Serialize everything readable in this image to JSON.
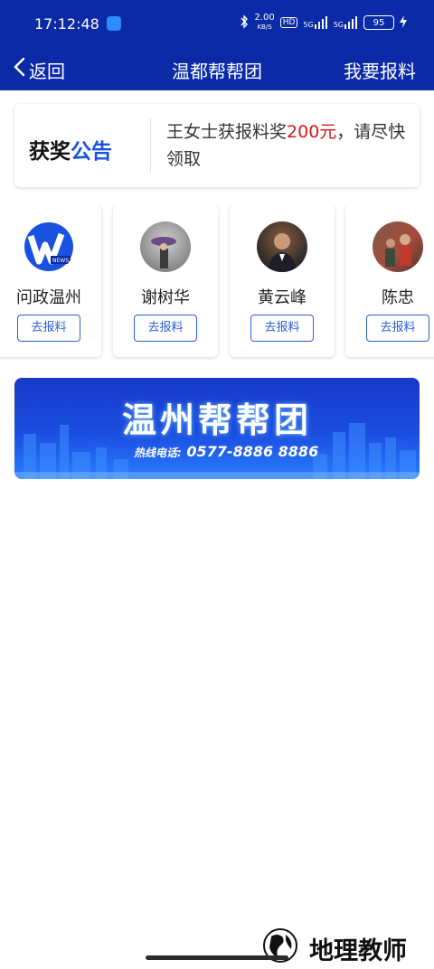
{
  "status_bar": {
    "time": "17:12:48",
    "net_speed_value": "2.00",
    "net_speed_unit": "KB/S",
    "hd_label": "HD",
    "signal1_label": "5G",
    "signal2_label": "5G",
    "battery": "95"
  },
  "nav": {
    "back_label": "返回",
    "title": "温都帮帮团",
    "action_label": "我要报料"
  },
  "notice": {
    "tag_part1": "获奖",
    "tag_part2": "公告",
    "text_before": "王女士获报料奖",
    "amount": "200元",
    "text_after": "，请尽快领取"
  },
  "reporters": [
    {
      "name": "问政温州",
      "button": "去报料",
      "icon": "news-logo-icon"
    },
    {
      "name": "谢树华",
      "button": "去报料",
      "icon": "avatar-photo"
    },
    {
      "name": "黄云峰",
      "button": "去报料",
      "icon": "avatar-photo"
    },
    {
      "name": "陈忠",
      "button": "去报料",
      "icon": "avatar-photo"
    }
  ],
  "banner": {
    "title": "温州帮帮团",
    "hotline_label": "热线电话:",
    "hotline_number": "0577-8886 8886"
  },
  "watermark": {
    "text": "地理教师"
  },
  "colors": {
    "header_bg": "#0b2aa8",
    "accent_blue": "#1a52e0",
    "amount_red": "#d5171b",
    "button_blue": "#2b5fd6"
  }
}
